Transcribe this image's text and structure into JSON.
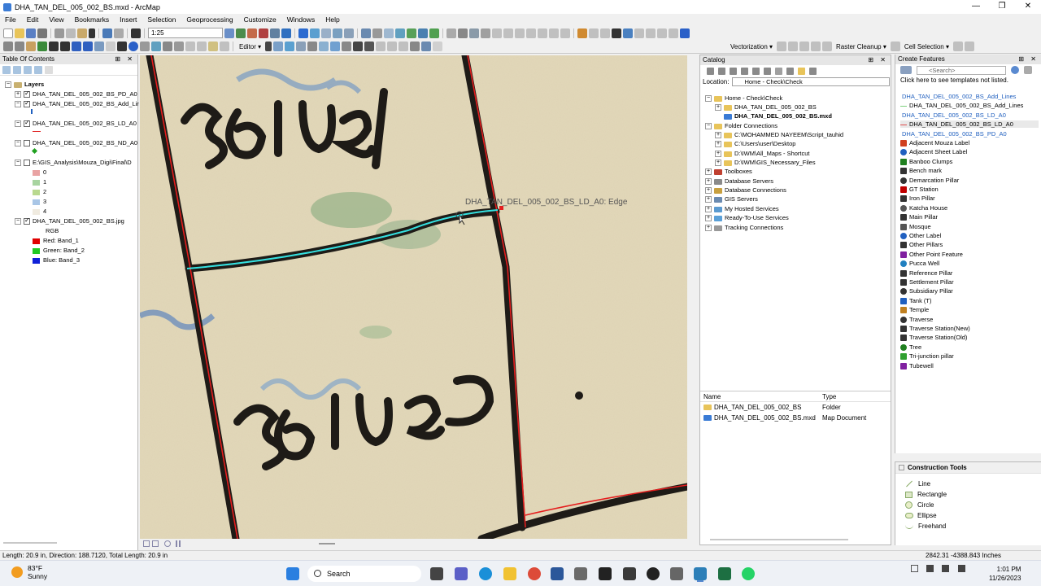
{
  "window": {
    "title": "DHA_TAN_DEL_005_002_BS.mxd - ArcMap",
    "controls": [
      "—",
      "❐",
      "✕"
    ]
  },
  "menu": [
    "File",
    "Edit",
    "View",
    "Bookmarks",
    "Insert",
    "Selection",
    "Geoprocessing",
    "Customize",
    "Windows",
    "Help"
  ],
  "toolbar": {
    "scale": "1:25",
    "editor": "Editor ▾",
    "vectorization": "Vectorization ▾",
    "raster_cleanup": "Raster Cleanup ▾",
    "cell_selection": "Cell Selection ▾"
  },
  "toc": {
    "title": "Table Of Contents",
    "layers_root": "Layers",
    "layers": [
      {
        "name": "DHA_TAN_DEL_005_002_BS_PD_A0",
        "checked": true
      },
      {
        "name": "DHA_TAN_DEL_005_002_BS_Add_Lir",
        "checked": true
      },
      {
        "name": "DHA_TAN_DEL_005_002_BS_LD_A0",
        "checked": true
      },
      {
        "name": "DHA_TAN_DEL_005_002_BS_ND_A0",
        "checked": false
      },
      {
        "name": "E:\\GIS_Analysis\\Mouza_Digi\\Final\\D",
        "checked": false
      },
      {
        "name": "DHA_TAN_DEL_005_002_BS.jpg",
        "checked": true
      }
    ],
    "classes": [
      "0",
      "1",
      "2",
      "3",
      "4"
    ],
    "class_colors": [
      "#e9a3a3",
      "#a8d4a0",
      "#b9d98f",
      "#a9c6e6",
      "#f0ebe0"
    ],
    "rgb_label": "RGB",
    "bands": [
      {
        "label": "Red:  Band_1",
        "color": "#e00000"
      },
      {
        "label": "Green: Band_2",
        "color": "#22c922"
      },
      {
        "label": "Blue:  Band_3",
        "color": "#1020d8"
      }
    ]
  },
  "map": {
    "edge_label": "DHA_TAN_DEL_005_002_BS_LD_A0: Edge"
  },
  "catalog": {
    "title": "Catalog",
    "location_label": "Location:",
    "location_value": "Home - Check\\Check",
    "tree": [
      {
        "label": "Home - Check\\Check",
        "indent": 0,
        "bold": false
      },
      {
        "label": "DHA_TAN_DEL_005_002_BS",
        "indent": 1,
        "bold": false
      },
      {
        "label": "DHA_TAN_DEL_005_002_BS.mxd",
        "indent": 1,
        "bold": true
      },
      {
        "label": "Folder Connections",
        "indent": 0,
        "bold": false
      },
      {
        "label": "C:\\MOHAMMED NAYEEM\\Script_tauhid",
        "indent": 1,
        "bold": false
      },
      {
        "label": "C:\\Users\\user\\Desktop",
        "indent": 1,
        "bold": false
      },
      {
        "label": "D:\\IWM\\All_Maps - Shortcut",
        "indent": 1,
        "bold": false
      },
      {
        "label": "D:\\IWM\\GIS_Necessary_Files",
        "indent": 1,
        "bold": false
      },
      {
        "label": "Toolboxes",
        "indent": 0,
        "bold": false
      },
      {
        "label": "Database Servers",
        "indent": 0,
        "bold": false
      },
      {
        "label": "Database Connections",
        "indent": 0,
        "bold": false
      },
      {
        "label": "GIS Servers",
        "indent": 0,
        "bold": false
      },
      {
        "label": "My Hosted Services",
        "indent": 0,
        "bold": false
      },
      {
        "label": "Ready-To-Use Services",
        "indent": 0,
        "bold": false
      },
      {
        "label": "Tracking Connections",
        "indent": 0,
        "bold": false
      }
    ],
    "list_headers": {
      "name": "Name",
      "type": "Type"
    },
    "list_rows": [
      {
        "name": "DHA_TAN_DEL_005_002_BS",
        "type": "Folder"
      },
      {
        "name": "DHA_TAN_DEL_005_002_BS.mxd",
        "type": "Map Document"
      }
    ]
  },
  "create_features": {
    "title": "Create Features",
    "search_placeholder": "<Search>",
    "notice": "Click here to see templates not listed.",
    "templates": [
      {
        "label": "DHA_TAN_DEL_005_002_BS_Add_Lines",
        "kind": "header",
        "color": "#1f5fbf"
      },
      {
        "label": "DHA_TAN_DEL_005_002_BS_Add_Lines",
        "kind": "item",
        "color": "#7fd07f"
      },
      {
        "label": "DHA_TAN_DEL_005_002_BS_LD_A0",
        "kind": "header",
        "color": "#1f5fbf"
      },
      {
        "label": "DHA_TAN_DEL_005_002_BS_LD_A0",
        "kind": "selected",
        "color": "#e05050"
      },
      {
        "label": "DHA_TAN_DEL_005_002_BS_PD_A0",
        "kind": "header",
        "color": "#1f5fbf"
      },
      {
        "label": "Adjacent Mouza Label",
        "kind": "item",
        "color": "#d04020"
      },
      {
        "label": "Adjacent Sheet Label",
        "kind": "item",
        "color": "#2060c0"
      },
      {
        "label": "Banboo Clumps",
        "kind": "item",
        "color": "#208020"
      },
      {
        "label": "Bench mark",
        "kind": "item",
        "color": "#333333"
      },
      {
        "label": "Demarcation Pillar",
        "kind": "item",
        "color": "#333333"
      },
      {
        "label": "GT Station",
        "kind": "item",
        "color": "#c00000"
      },
      {
        "label": "Iron Pillar",
        "kind": "item",
        "color": "#333333"
      },
      {
        "label": "Katcha House",
        "kind": "item",
        "color": "#555555"
      },
      {
        "label": "Main Pillar",
        "kind": "item",
        "color": "#333333"
      },
      {
        "label": "Mosque",
        "kind": "item",
        "color": "#555555"
      },
      {
        "label": "Other Label",
        "kind": "item",
        "color": "#2060c0"
      },
      {
        "label": "Other Pillars",
        "kind": "item",
        "color": "#333333"
      },
      {
        "label": "Other Point Feature",
        "kind": "item",
        "color": "#8020a0"
      },
      {
        "label": "Pucca Well",
        "kind": "item",
        "color": "#2080c0"
      },
      {
        "label": "Reference Pillar",
        "kind": "item",
        "color": "#333333"
      },
      {
        "label": "Settlement Pillar",
        "kind": "item",
        "color": "#333333"
      },
      {
        "label": "Subsidiary Pillar",
        "kind": "item",
        "color": "#333333"
      },
      {
        "label": "Tank (T)",
        "kind": "item",
        "color": "#2060c0"
      },
      {
        "label": "Temple",
        "kind": "item",
        "color": "#c08020"
      },
      {
        "label": "Traverse",
        "kind": "item",
        "color": "#333333"
      },
      {
        "label": "Traverse Station(New)",
        "kind": "item",
        "color": "#333333"
      },
      {
        "label": "Traverse Station(Old)",
        "kind": "item",
        "color": "#333333"
      },
      {
        "label": "Tree",
        "kind": "item",
        "color": "#208020"
      },
      {
        "label": "Tri-junction pillar",
        "kind": "item",
        "color": "#30a030"
      },
      {
        "label": "Tubewell",
        "kind": "item",
        "color": "#8020a0"
      }
    ],
    "construction_title": "Construction Tools",
    "construction_tools": [
      "Line",
      "Rectangle",
      "Circle",
      "Ellipse",
      "Freehand"
    ]
  },
  "status": {
    "left": "Length: 20.9 in, Direction: 188.7120, Total Length: 20.9 in",
    "right": "2842.31  -4388.843 Inches"
  },
  "taskbar": {
    "weather_temp": "83°F",
    "weather_desc": "Sunny",
    "search": "Search",
    "time": "1:01 PM",
    "date": "11/26/2023"
  }
}
